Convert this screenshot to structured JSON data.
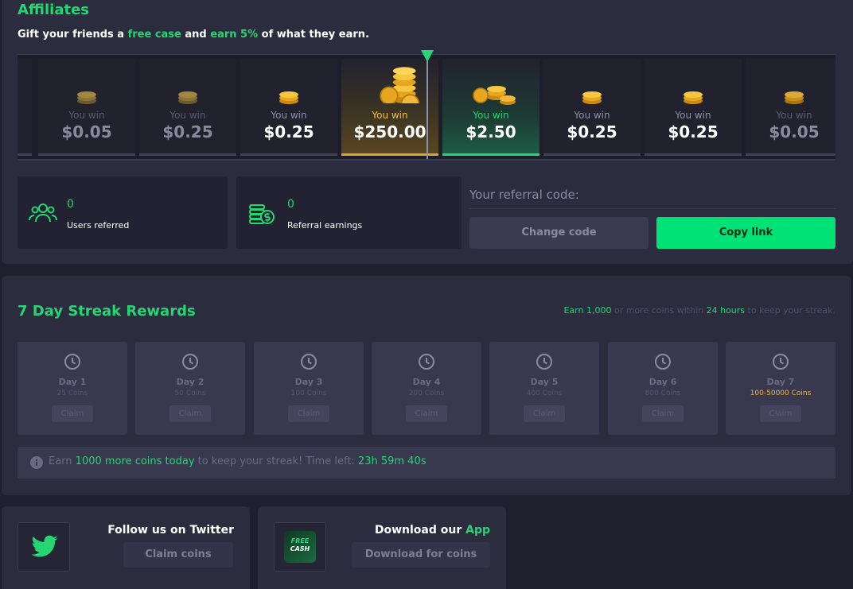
{
  "affiliates": {
    "title": "Affiliates",
    "subtitle_parts": [
      "Gift your friends a ",
      "free case",
      " and ",
      "earn 5%",
      " of what they earn."
    ],
    "spinner": [
      {
        "label": "You win",
        "value": "$0.05",
        "style": "dim",
        "coin": "bronze"
      },
      {
        "label": "You win",
        "value": "$0.25",
        "style": "dim",
        "coin": "bronze"
      },
      {
        "label": "You win",
        "value": "$0.25",
        "style": "normal",
        "coin": "gold"
      },
      {
        "label": "You win",
        "value": "$250.00",
        "style": "gold",
        "coin": "gold-pile"
      },
      {
        "label": "You win",
        "value": "$2.50",
        "style": "green",
        "coin": "gold-stacks"
      },
      {
        "label": "You win",
        "value": "$0.25",
        "style": "normal",
        "coin": "gold"
      },
      {
        "label": "You win",
        "value": "$0.25",
        "style": "normal",
        "coin": "gold"
      },
      {
        "label": "You win",
        "value": "$0.05",
        "style": "dim",
        "coin": "gold"
      }
    ],
    "stats": {
      "users_referred": {
        "value": "0",
        "label": "Users referred",
        "icon": "users-icon"
      },
      "referral_earnings": {
        "value": "0",
        "label": "Referral earnings",
        "icon": "coins-dollar-icon"
      }
    },
    "referral_code_label": "Your referral code:",
    "change_code_label": "Change code",
    "copy_link_label": "Copy link"
  },
  "streak": {
    "title": "7 Day Streak Rewards",
    "note_parts": [
      "Earn 1,000",
      " or more coins within ",
      "24 hours",
      " to keep your streak."
    ],
    "days": [
      {
        "name": "Day 1",
        "coins": "25 Coins",
        "claim": "Claim"
      },
      {
        "name": "Day 2",
        "coins": "50 Coins",
        "claim": "Claim"
      },
      {
        "name": "Day 3",
        "coins": "100 Coins",
        "claim": "Claim"
      },
      {
        "name": "Day 4",
        "coins": "200 Coins",
        "claim": "Claim"
      },
      {
        "name": "Day 5",
        "coins": "400 Coins",
        "claim": "Claim"
      },
      {
        "name": "Day 6",
        "coins": "800 Coins",
        "claim": "Claim"
      },
      {
        "name": "Day 7",
        "coins": "100-50000 Coins",
        "claim": "Claim"
      }
    ],
    "time_parts": [
      "Earn ",
      "1000 more coins today",
      " to keep your streak! Time left: ",
      "23h 59m 40s"
    ]
  },
  "twitter": {
    "title": "Follow us on Twitter",
    "button": "Claim coins"
  },
  "app": {
    "title_parts": [
      "Download our ",
      "App"
    ],
    "button": "Download for coins",
    "logo_text": [
      "FREE",
      "CASH"
    ]
  },
  "colors": {
    "accent": "#26d672",
    "button_green": "#00e276",
    "gold": "#f2c04a",
    "panel": "#2c2c3f",
    "background": "#1f1f2d"
  }
}
